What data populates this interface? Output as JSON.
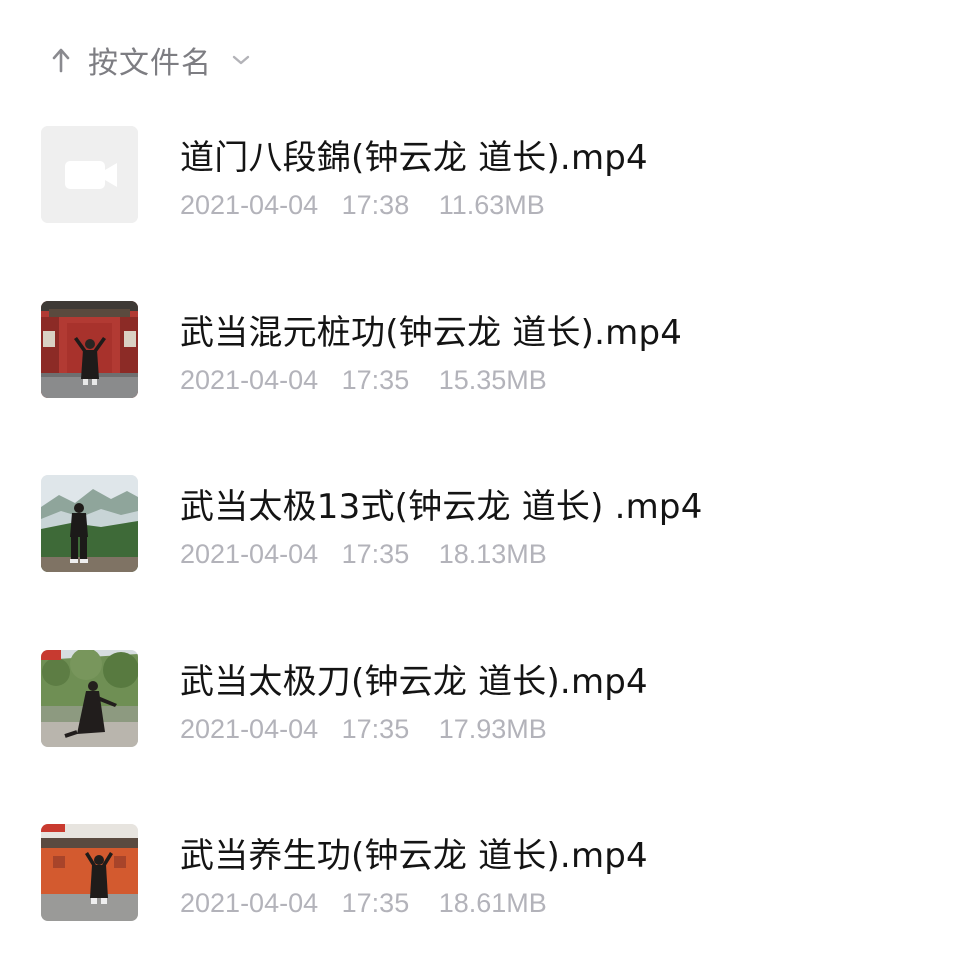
{
  "sort": {
    "label": "按文件名",
    "direction_icon": "arrow-up-icon",
    "dropdown_icon": "chevron-down-icon"
  },
  "colors": {
    "text_primary": "#141414",
    "text_secondary": "#b3b3ba",
    "sort_text": "#7d7d82",
    "placeholder_bg": "#efefef"
  },
  "files": [
    {
      "name": "道门八段錦(钟云龙 道长).mp4",
      "date": "2021-04-04",
      "time": "17:38",
      "size": "11.63MB",
      "thumbnail": "video-placeholder-icon"
    },
    {
      "name": "武当混元桩功(钟云龙 道长).mp4",
      "date": "2021-04-04",
      "time": "17:35",
      "size": "15.35MB",
      "thumbnail": "temple-gate-thumbnail"
    },
    {
      "name": "武当太极13式(钟云龙 道长) .mp4",
      "date": "2021-04-04",
      "time": "17:35",
      "size": "18.13MB",
      "thumbnail": "mountain-thumbnail"
    },
    {
      "name": "武当太极刀(钟云龙 道长).mp4",
      "date": "2021-04-04",
      "time": "17:35",
      "size": "17.93MB",
      "thumbnail": "forest-terrace-thumbnail"
    },
    {
      "name": "武当养生功(钟云龙 道长).mp4",
      "date": "2021-04-04",
      "time": "17:35",
      "size": "18.61MB",
      "thumbnail": "red-wall-thumbnail"
    }
  ]
}
